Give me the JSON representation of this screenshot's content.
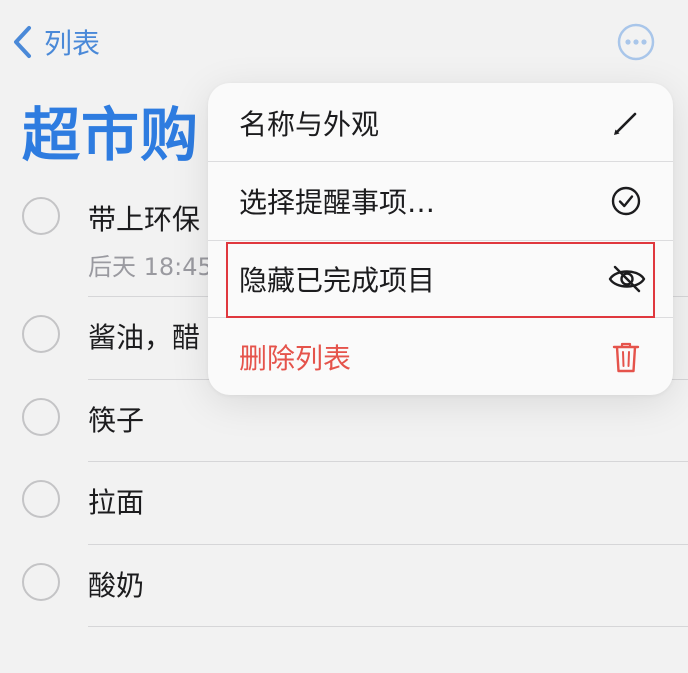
{
  "nav": {
    "back_label": "列表",
    "back_icon": "chevron-left-icon",
    "more_icon": "ellipsis-circle-icon"
  },
  "page": {
    "title": "超市购"
  },
  "reminders": [
    {
      "title": "带上环保",
      "subtitle": "后天 18:45"
    },
    {
      "title": "酱油，醋",
      "subtitle": ""
    },
    {
      "title": "筷子",
      "subtitle": ""
    },
    {
      "title": "拉面",
      "subtitle": ""
    },
    {
      "title": "酸奶",
      "subtitle": ""
    }
  ],
  "menu": {
    "items": [
      {
        "label": "名称与外观",
        "icon": "pencil-icon"
      },
      {
        "label": "选择提醒事项…",
        "icon": "checkmark-circle-icon"
      },
      {
        "label": "隐藏已完成项目",
        "icon": "eye-slash-icon"
      },
      {
        "label": "删除列表",
        "icon": "trash-icon"
      }
    ]
  },
  "colors": {
    "accent": "#2e7ce0",
    "destructive": "#e5534b",
    "highlight_border": "#e0383e"
  }
}
